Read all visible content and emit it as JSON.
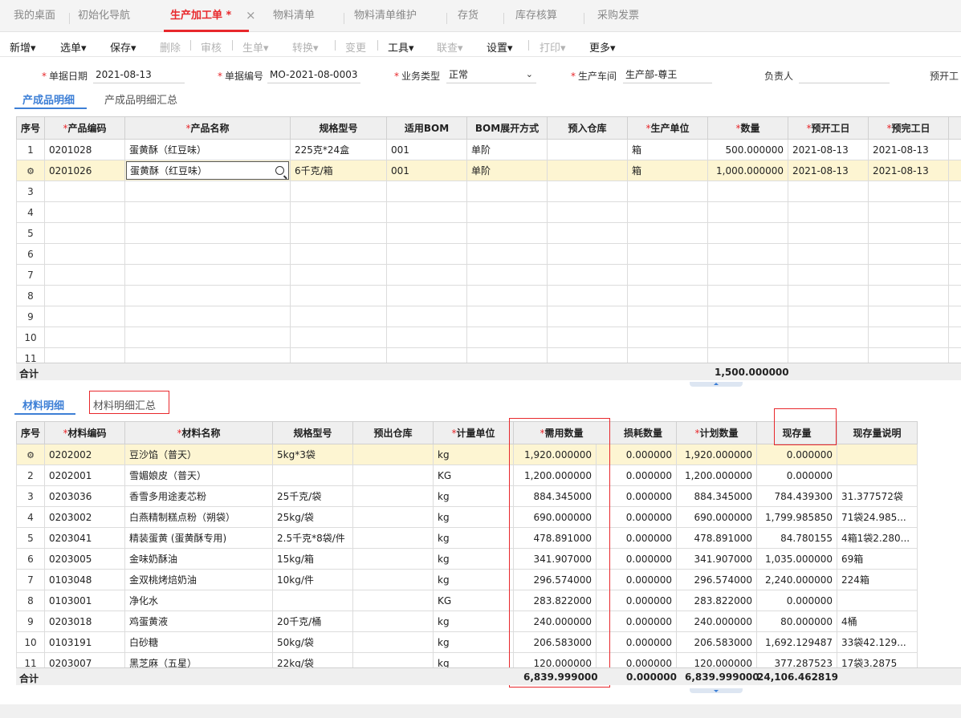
{
  "tabs": [
    {
      "label": "我的桌面"
    },
    {
      "label": "初始化导航"
    },
    {
      "label": "生产加工单 *"
    },
    {
      "label": "物料清单"
    },
    {
      "label": "物料清单维护"
    },
    {
      "label": "存货"
    },
    {
      "label": "库存核算"
    },
    {
      "label": "采购发票"
    }
  ],
  "close_symbol": "×",
  "toolbar": {
    "new": "新增",
    "select": "选单",
    "save": "保存",
    "delete": "删除",
    "audit": "审核",
    "generate": "生单",
    "convert": "转换",
    "change": "变更",
    "tools": "工具",
    "link": "联查",
    "settings": "设置",
    "print": "打印",
    "more": "更多"
  },
  "header": {
    "date_label": "单据日期",
    "date_value": "2021-08-13",
    "code_label": "单据编号",
    "code_value": "MO-2021-08-0003",
    "biztype_label": "业务类型",
    "biztype_value": "正常",
    "workshop_label": "生产车间",
    "workshop_value": "生产部-尊王",
    "owner_label": "负责人",
    "owner_value": "",
    "start_label": "预开工"
  },
  "product_tabs": {
    "detail": "产成品明细",
    "summary": "产成品明细汇总"
  },
  "product_table": {
    "columns": [
      "序号",
      "产品编码",
      "产品名称",
      "规格型号",
      "适用BOM",
      "BOM展开方式",
      "预入仓库",
      "生产单位",
      "数量",
      "预开工日",
      "预完工日"
    ],
    "rows": [
      {
        "idx": "1",
        "code": "0201028",
        "name": "蛋黄酥（红豆味）",
        "spec": "225克*24盒",
        "bom": "001",
        "expand": "单阶",
        "wh": "",
        "unit": "箱",
        "qty": "500.000000",
        "start": "2021-08-13",
        "end": "2021-08-13"
      },
      {
        "idx": "",
        "code": "0201026",
        "name": "蛋黄酥（红豆味）",
        "spec": "6千克/箱",
        "bom": "001",
        "expand": "单阶",
        "wh": "",
        "unit": "箱",
        "qty": "1,000.000000",
        "start": "2021-08-13",
        "end": "2021-08-13"
      }
    ],
    "empty_rows": [
      "3",
      "4",
      "5",
      "6",
      "7",
      "8",
      "9",
      "10",
      "11"
    ],
    "sum_label": "合计",
    "sum_qty": "1,500.000000"
  },
  "material_tabs": {
    "detail": "材料明细",
    "summary": "材料明细汇总"
  },
  "material_table": {
    "columns": [
      "序号",
      "材料编码",
      "材料名称",
      "规格型号",
      "预出仓库",
      "计量单位",
      "需用数量",
      "损耗数量",
      "计划数量",
      "现存量",
      "现存量说明"
    ],
    "rows": [
      {
        "idx": "",
        "code": "0202002",
        "name": "豆沙馅（普天）",
        "spec": "5kg*3袋",
        "wh": "",
        "unit": "kg",
        "need": "1,920.000000",
        "loss": "0.000000",
        "plan": "1,920.000000",
        "stock": "0.000000",
        "note": ""
      },
      {
        "idx": "2",
        "code": "0202001",
        "name": "雪媚娘皮（普天）",
        "spec": "",
        "wh": "",
        "unit": "KG",
        "need": "1,200.000000",
        "loss": "0.000000",
        "plan": "1,200.000000",
        "stock": "0.000000",
        "note": ""
      },
      {
        "idx": "3",
        "code": "0203036",
        "name": "香雪多用途麦芯粉",
        "spec": "25千克/袋",
        "wh": "",
        "unit": "kg",
        "need": "884.345000",
        "loss": "0.000000",
        "plan": "884.345000",
        "stock": "784.439300",
        "note": "31.377572袋"
      },
      {
        "idx": "4",
        "code": "0203002",
        "name": "白燕精制糕点粉（朔袋）",
        "spec": "25kg/袋",
        "wh": "",
        "unit": "kg",
        "need": "690.000000",
        "loss": "0.000000",
        "plan": "690.000000",
        "stock": "1,799.985850",
        "note": "71袋24.985..."
      },
      {
        "idx": "5",
        "code": "0203041",
        "name": "精装蛋黄 (蛋黄酥专用)",
        "spec": "2.5千克*8袋/件",
        "wh": "",
        "unit": "kg",
        "need": "478.891000",
        "loss": "0.000000",
        "plan": "478.891000",
        "stock": "84.780155",
        "note": "4箱1袋2.280..."
      },
      {
        "idx": "6",
        "code": "0203005",
        "name": "金味奶酥油",
        "spec": "15kg/箱",
        "wh": "",
        "unit": "kg",
        "need": "341.907000",
        "loss": "0.000000",
        "plan": "341.907000",
        "stock": "1,035.000000",
        "note": "69箱"
      },
      {
        "idx": "7",
        "code": "0103048",
        "name": "金双桃烤焙奶油",
        "spec": "10kg/件",
        "wh": "",
        "unit": "kg",
        "need": "296.574000",
        "loss": "0.000000",
        "plan": "296.574000",
        "stock": "2,240.000000",
        "note": "224箱"
      },
      {
        "idx": "8",
        "code": "0103001",
        "name": "净化水",
        "spec": "",
        "wh": "",
        "unit": "KG",
        "need": "283.822000",
        "loss": "0.000000",
        "plan": "283.822000",
        "stock": "0.000000",
        "note": ""
      },
      {
        "idx": "9",
        "code": "0203018",
        "name": "鸡蛋黄液",
        "spec": "20千克/桶",
        "wh": "",
        "unit": "kg",
        "need": "240.000000",
        "loss": "0.000000",
        "plan": "240.000000",
        "stock": "80.000000",
        "note": "4桶"
      },
      {
        "idx": "10",
        "code": "0103191",
        "name": "白砂糖",
        "spec": "50kg/袋",
        "wh": "",
        "unit": "kg",
        "need": "206.583000",
        "loss": "0.000000",
        "plan": "206.583000",
        "stock": "1,692.129487",
        "note": "33袋42.129..."
      },
      {
        "idx": "11",
        "code": "0203007",
        "name": "黑芝麻（五星）",
        "spec": "22kg/袋",
        "wh": "",
        "unit": "kg",
        "need": "120.000000",
        "loss": "0.000000",
        "plan": "120.000000",
        "stock": "377.287523",
        "note": "17袋3.2875"
      }
    ],
    "sum_label": "合计",
    "sum_need": "6,839.999000",
    "sum_loss": "0.000000",
    "sum_plan": "6,839.999000",
    "sum_stock": "24,106.462819"
  }
}
